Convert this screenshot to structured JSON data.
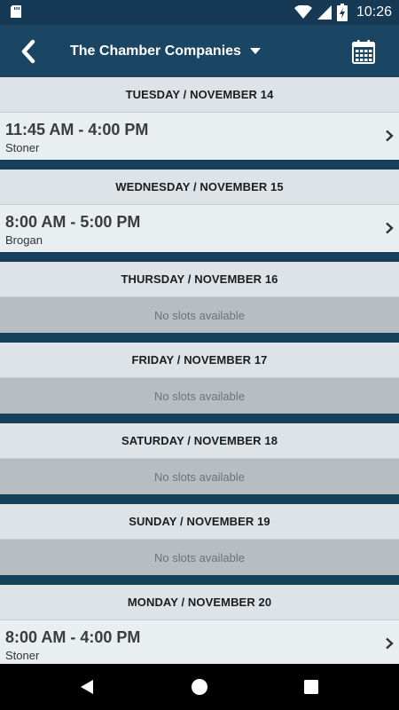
{
  "status_bar": {
    "time": "10:26",
    "icons": [
      "sd-card-icon",
      "wifi-icon",
      "cell-signal-icon",
      "battery-charging-icon"
    ]
  },
  "app_bar": {
    "title": "The Chamber Companies",
    "back_icon": "chevron-left-icon",
    "dropdown_icon": "caret-down-icon",
    "calendar_icon": "calendar-icon"
  },
  "days": [
    {
      "header": "TUESDAY / NOVEMBER 14",
      "slot": {
        "time": "11:45 AM - 4:00 PM",
        "person": "Stoner"
      }
    },
    {
      "header": "WEDNESDAY / NOVEMBER 15",
      "slot": {
        "time": "8:00 AM - 5:00 PM",
        "person": "Brogan"
      }
    },
    {
      "header": "THURSDAY / NOVEMBER 16",
      "empty": "No slots available"
    },
    {
      "header": "FRIDAY / NOVEMBER 17",
      "empty": "No slots available"
    },
    {
      "header": "SATURDAY / NOVEMBER 18",
      "empty": "No slots available"
    },
    {
      "header": "SUNDAY / NOVEMBER 19",
      "empty": "No slots available"
    },
    {
      "header": "MONDAY / NOVEMBER 20",
      "slot": {
        "time": "8:00 AM - 4:00 PM",
        "person": "Stoner"
      }
    }
  ],
  "nav_bar": {
    "icons": [
      "back-triangle-icon",
      "home-circle-icon",
      "recents-square-icon"
    ]
  },
  "colors": {
    "app_bar": "#1a4563",
    "status_bar": "#163a55",
    "day_header": "#dde3e7",
    "slot_bg": "#e9eef1",
    "empty_bg": "#b8bdc2",
    "separator": "#17405c"
  }
}
